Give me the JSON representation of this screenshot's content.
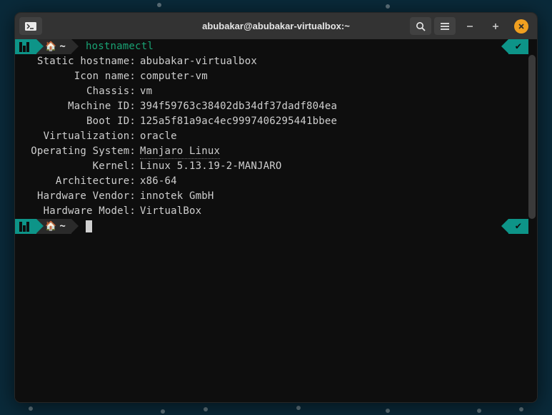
{
  "titlebar": {
    "window_title": "abubakar@abubakar-virtualbox:~"
  },
  "prompt": {
    "path": "~",
    "command": "hostnamectl"
  },
  "output": {
    "rows": [
      {
        "key": "Static hostname:",
        "val": "abubakar-virtualbox"
      },
      {
        "key": "Icon name:",
        "val": "computer-vm"
      },
      {
        "key": "Chassis:",
        "val": "vm"
      },
      {
        "key": "Machine ID:",
        "val": "394f59763c38402db34df37dadf804ea"
      },
      {
        "key": "Boot ID:",
        "val": "125a5f81a9ac4ec9997406295441bbee"
      },
      {
        "key": "Virtualization:",
        "val": "oracle"
      },
      {
        "key": "Operating System:",
        "val": "Manjaro Linux",
        "underline": true
      },
      {
        "key": "Kernel:",
        "val": "Linux 5.13.19-2-MANJARO"
      },
      {
        "key": "Architecture:",
        "val": "x86-64"
      },
      {
        "key": "Hardware Vendor:",
        "val": "innotek GmbH"
      },
      {
        "key": "Hardware Model:",
        "val": "VirtualBox"
      }
    ]
  },
  "status": {
    "check": "✔"
  }
}
